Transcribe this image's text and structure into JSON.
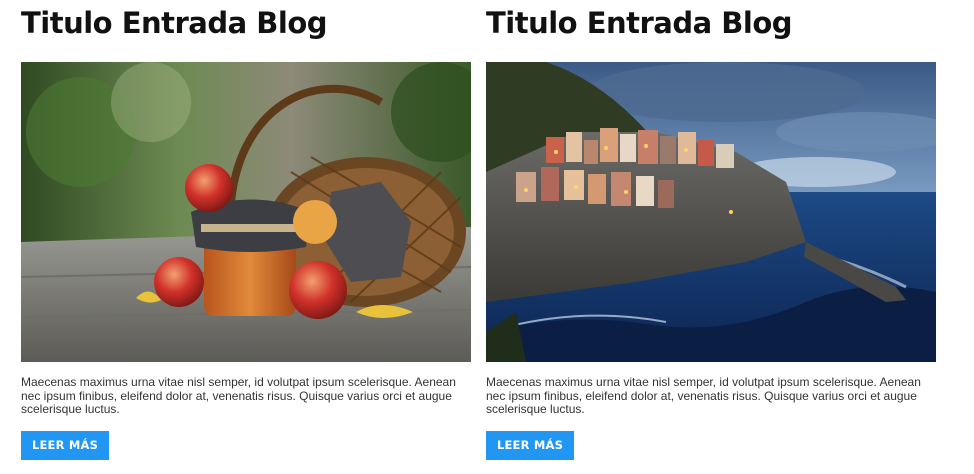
{
  "posts": [
    {
      "title": "Titulo Entrada Blog",
      "image_subject": "basket-of-apples-and-jam-jar",
      "excerpt": "Maecenas maximus urna vitae nisl semper, id volutpat ipsum scelerisque. Aenean nec ipsum finibus, eleifend dolor at, venenatis risus. Quisque varius orci et augue scelerisque luctus.",
      "button_label": "LEER MÁS"
    },
    {
      "title": "Titulo Entrada Blog",
      "image_subject": "coastal-cliff-village-at-dusk",
      "excerpt": "Maecenas maximus urna vitae nisl semper, id volutpat ipsum scelerisque. Aenean nec ipsum finibus, eleifend dolor at, venenatis risus. Quisque varius orci et augue scelerisque luctus.",
      "button_label": "LEER MÁS"
    }
  ],
  "colors": {
    "button": "#2196f3",
    "button_text": "#ffffff",
    "title": "#111111",
    "body_text": "#333333"
  }
}
